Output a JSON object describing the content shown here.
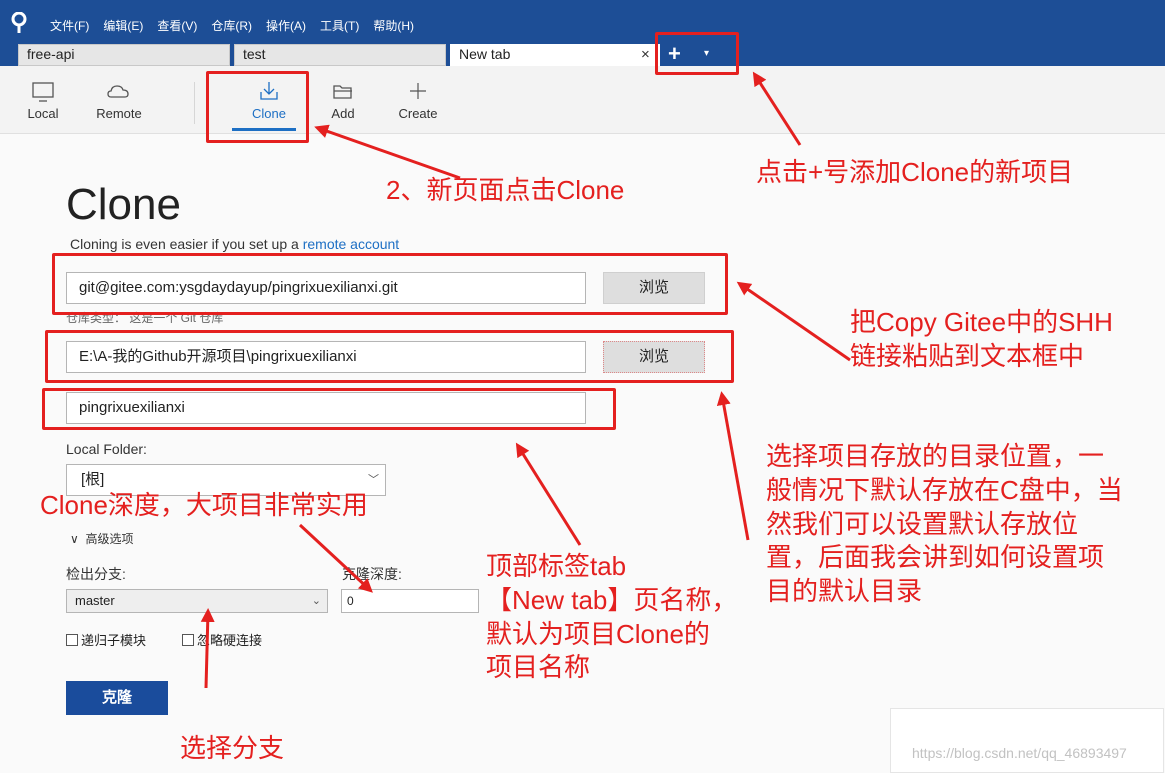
{
  "menu": [
    "文件(F)",
    "编辑(E)",
    "查看(V)",
    "仓库(R)",
    "操作(A)",
    "工具(T)",
    "帮助(H)"
  ],
  "tabs": [
    {
      "label": "free-api"
    },
    {
      "label": "test"
    },
    {
      "label": "New tab",
      "close": "×"
    }
  ],
  "tab_actions": {
    "add": "+",
    "dropdown": "▾"
  },
  "toolbar": {
    "local": "Local",
    "remote": "Remote",
    "clone": "Clone",
    "add": "Add",
    "create": "Create"
  },
  "page": {
    "title": "Clone",
    "subtitle": "Cloning is even easier if you set up a ",
    "subtitle_link": "remote account"
  },
  "form": {
    "url_value": "git@gitee.com:ysgdaydayup/pingrixuexilianxi.git",
    "browse1": "浏览",
    "repo_type_note": "仓库类型：  这是一个 Git 仓库",
    "path_value": "E:\\A-我的Github开源项目\\pingrixuexilianxi",
    "browse2": "浏览",
    "name_value": "pingrixuexilianxi",
    "local_folder_label": "Local Folder:",
    "local_folder_value": "[根]",
    "advanced_label": "高级选项",
    "branch_label": "检出分支:",
    "branch_value": "master",
    "depth_label": "克隆深度:",
    "depth_value": "0",
    "recursive_submodules": "递归子模块",
    "ignore_hardlinks": "忽略硬连接",
    "clone_button": "克隆"
  },
  "annotations": {
    "a1": "2、新页面点击Clone",
    "a2": "点击+号添加Clone的新项目",
    "a3": [
      "把Copy Gitee中的SHH",
      "链接粘贴到文本框中"
    ],
    "a4": [
      "选择项目存放的目录位置，一",
      "般情况下默认存放在C盘中，当",
      "然我们可以设置默认存放位",
      "置，后面我会讲到如何设置项",
      "目的默认目录"
    ],
    "a5": "Clone深度，大项目非常实用",
    "a6": [
      "顶部标签tab",
      "【New tab】页名称，",
      "默认为项目Clone的",
      "项目名称"
    ],
    "a7": "选择分支"
  },
  "watermark": "https://blog.csdn.net/qq_46893497",
  "colors": {
    "titlebar": "#1d4e96",
    "accent": "#1d6fc4",
    "annotation": "#e4201f",
    "clone_button": "#1a4c9c"
  }
}
